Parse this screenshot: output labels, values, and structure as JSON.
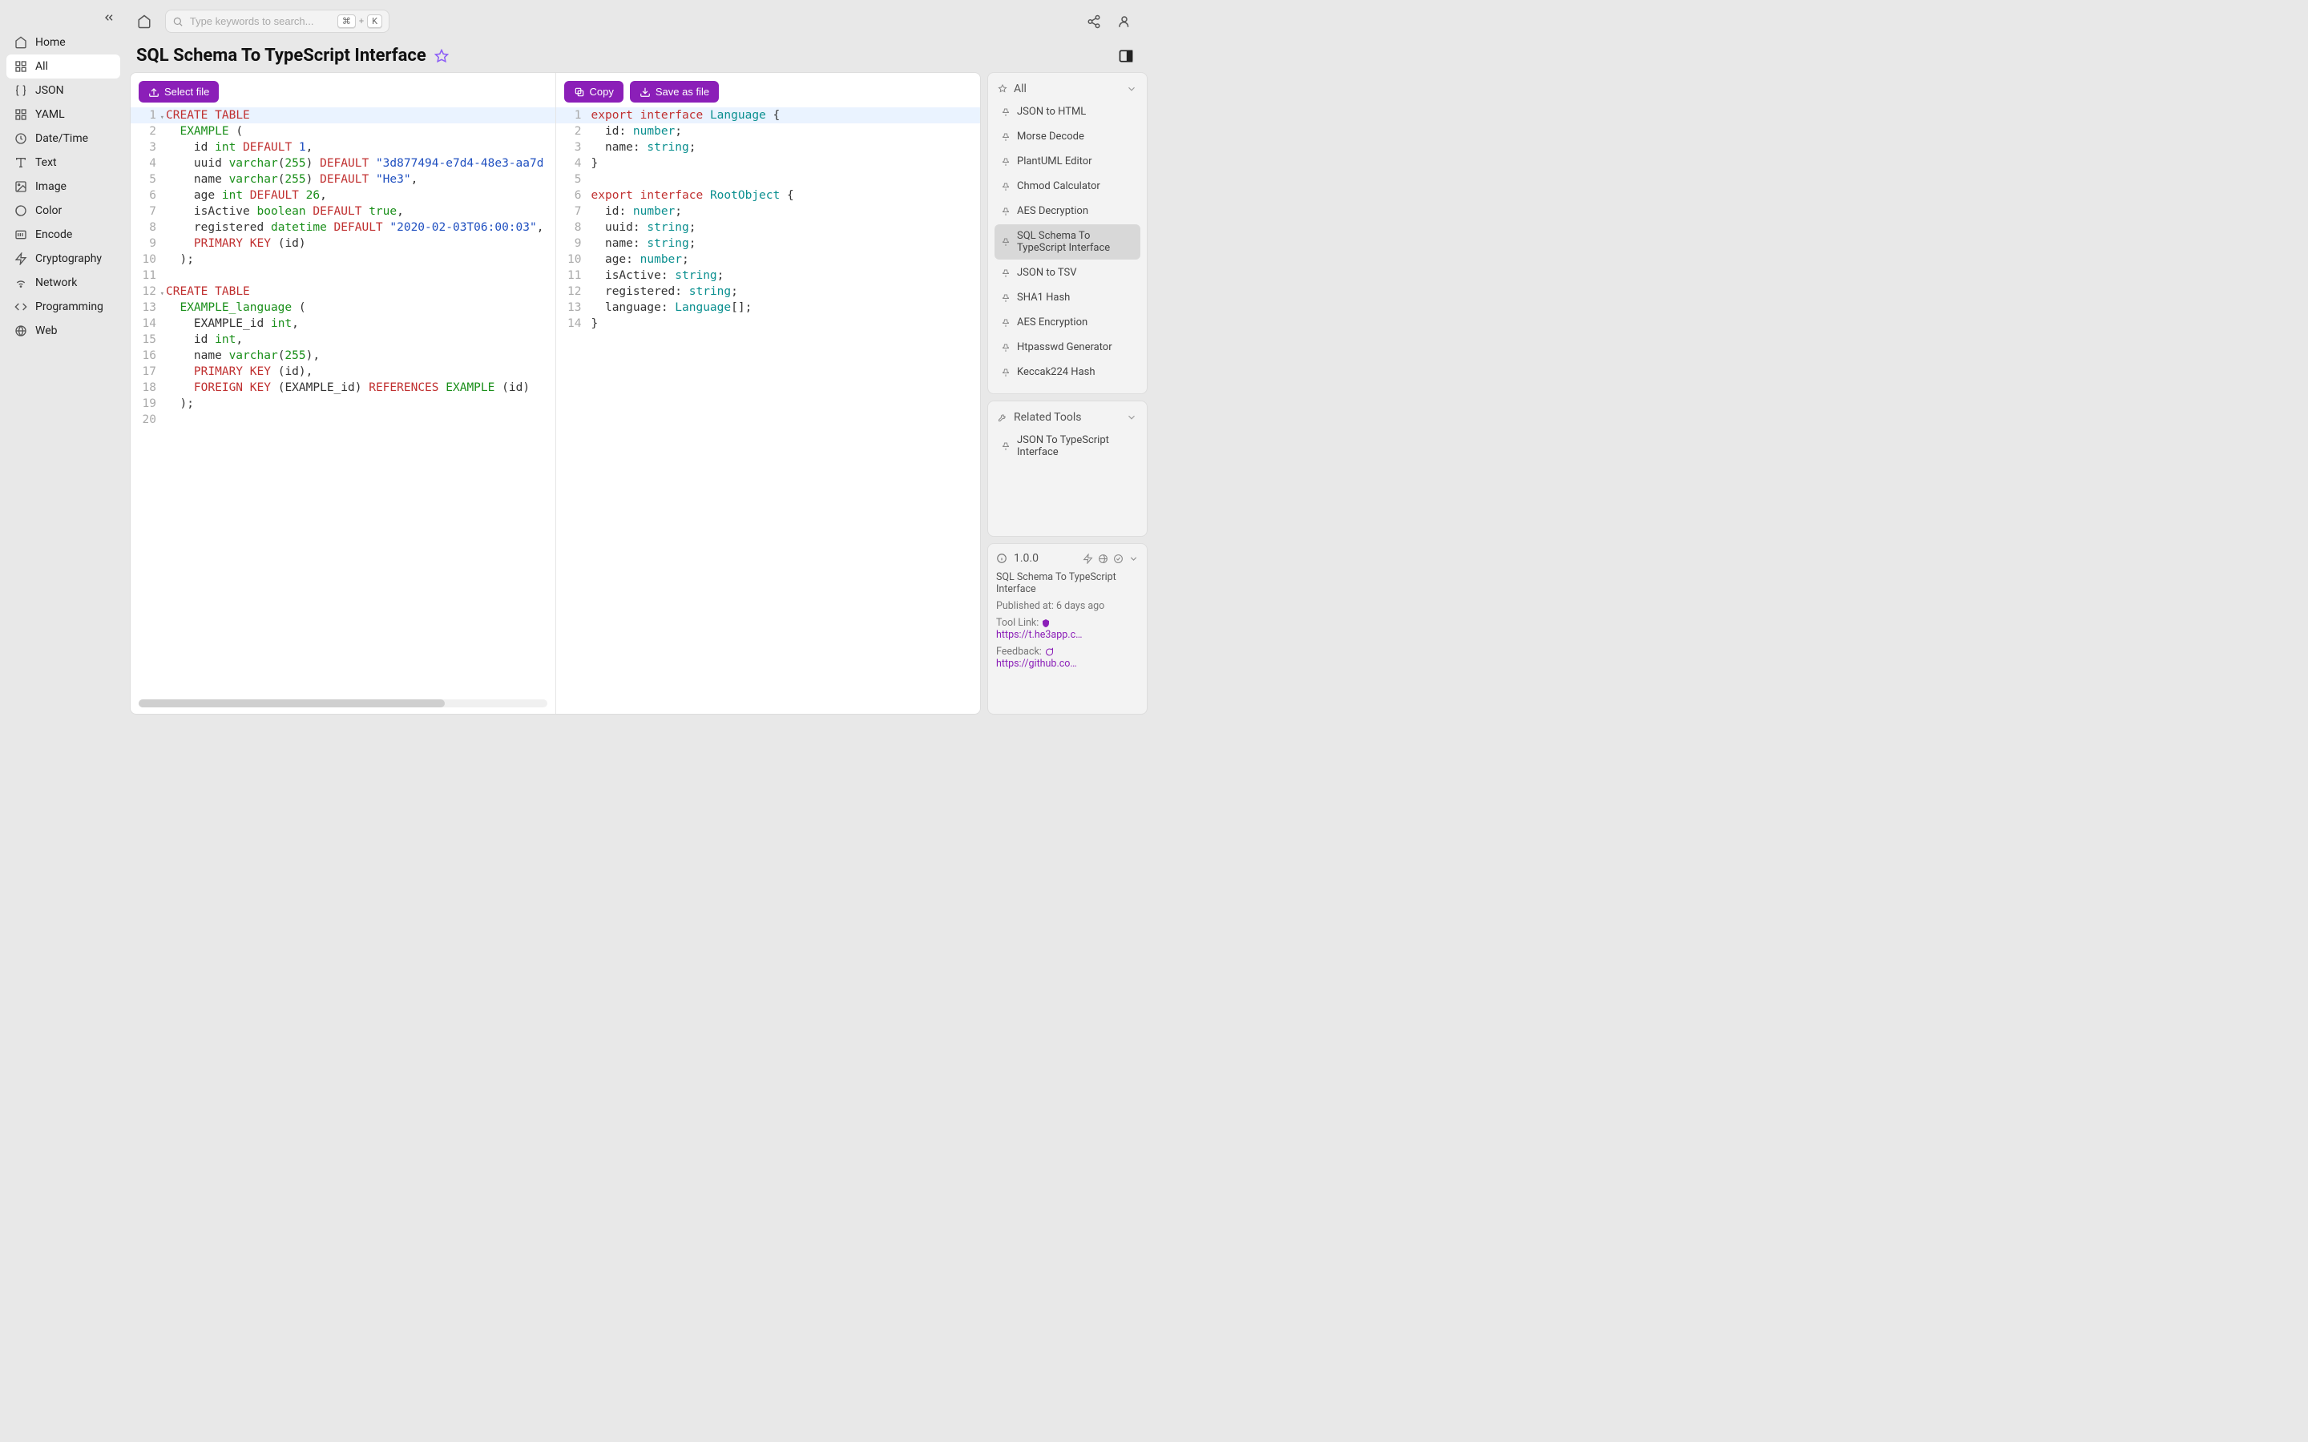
{
  "search": {
    "placeholder": "Type keywords to search...",
    "kbd_cmd": "⌘",
    "kbd_plus": "+",
    "kbd_k": "K"
  },
  "sidebar": {
    "items": [
      {
        "label": "Home"
      },
      {
        "label": "All"
      },
      {
        "label": "JSON"
      },
      {
        "label": "YAML"
      },
      {
        "label": "Date/Time"
      },
      {
        "label": "Text"
      },
      {
        "label": "Image"
      },
      {
        "label": "Color"
      },
      {
        "label": "Encode"
      },
      {
        "label": "Cryptography"
      },
      {
        "label": "Network"
      },
      {
        "label": "Programming"
      },
      {
        "label": "Web"
      }
    ]
  },
  "page": {
    "title": "SQL Schema To TypeScript Interface"
  },
  "toolbar_left": {
    "select_file": "Select file"
  },
  "toolbar_right": {
    "copy": "Copy",
    "save": "Save as file"
  },
  "left_lines": {
    "count": 20
  },
  "right_lines": {
    "count": 14
  },
  "sql_text": {
    "uuid_default": "\"3d877494-e7d4-48e3-aa7d",
    "name_default": "\"He3\"",
    "age_default": "26",
    "datetime_default": "\"2020-02-03T06:00:03\""
  },
  "rail": {
    "filter_label": "All",
    "tools": [
      "JSON to HTML",
      "Morse Decode",
      "PlantUML Editor",
      "Chmod Calculator",
      "AES Decryption",
      "SQL Schema To TypeScript Interface",
      "JSON to TSV",
      "SHA1 Hash",
      "AES Encryption",
      "Htpasswd Generator",
      "Keccak224 Hash"
    ],
    "related_label": "Related Tools",
    "related": [
      "JSON To TypeScript Interface"
    ],
    "info": {
      "version": "1.0.0",
      "name": "SQL Schema To TypeScript Interface",
      "published_label": "Published at:",
      "published_value": "6 days ago",
      "tool_link_label": "Tool Link:",
      "tool_link_value": "https://t.he3app.co…",
      "feedback_label": "Feedback:",
      "feedback_value": "https://github.com/…"
    }
  }
}
